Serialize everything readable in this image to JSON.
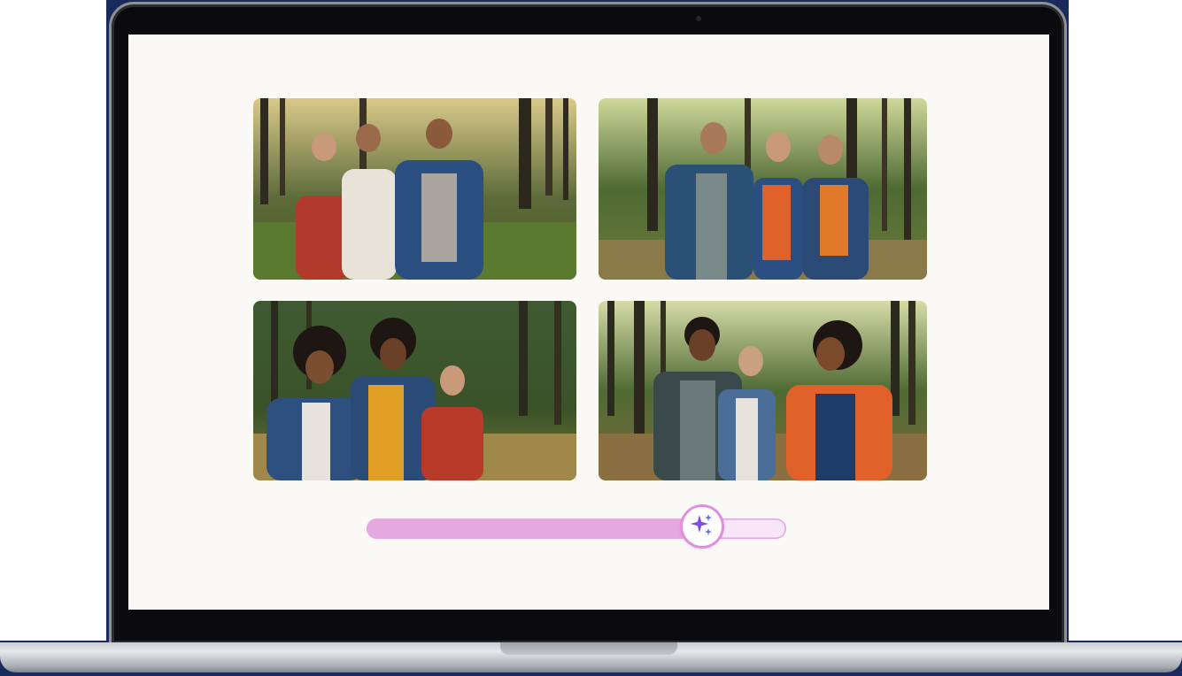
{
  "device": {
    "frame_color": "#0b0b0d",
    "screen_color": "#faf9f6",
    "backdrop_color": "#1b2a5c"
  },
  "gallery": {
    "photos": [
      {
        "id": "photo-1",
        "description_icon": "group-photo",
        "people": 3
      },
      {
        "id": "photo-2",
        "description_icon": "group-photo",
        "people": 3
      },
      {
        "id": "photo-3",
        "description_icon": "group-photo",
        "people": 3
      },
      {
        "id": "photo-4",
        "description_icon": "group-photo",
        "people": 3
      }
    ]
  },
  "slider": {
    "value": 0.8,
    "fill_color": "#e6a8e0",
    "track_color": "#f6e6f7",
    "thumb_icon": "sparkles-icon",
    "thumb_icon_color": "#7b4fe0"
  }
}
